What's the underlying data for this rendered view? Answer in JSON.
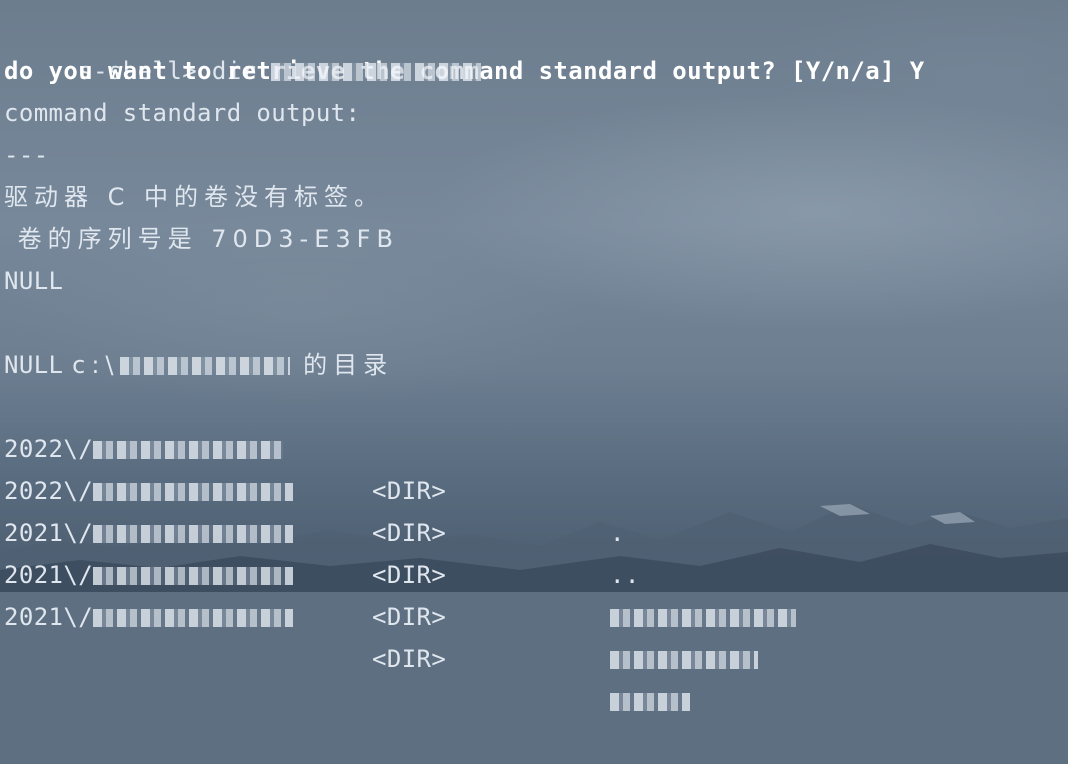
{
  "terminal": {
    "prompt_line": "os-shell> dir",
    "question": "do you want to retrieve the command standard output? [Y/n/a] Y",
    "output_header": "command standard output:",
    "separator": "---",
    "volume_label_line": "驱动器 C 中的卷没有标签。",
    "volume_serial_line": " 卷的序列号是 70D3-E3FB",
    "null_1": "NULL",
    "directory_prefix": " c:\\",
    "directory_suffix": " 的目录",
    "null_2": "NULL",
    "rows": [
      {
        "date": "2022\\/",
        "tag": "<DIR>",
        "name": "."
      },
      {
        "date": "2022\\/",
        "tag": "<DIR>",
        "name": ".."
      },
      {
        "date": "2021\\/",
        "tag": "<DIR>",
        "name": ""
      },
      {
        "date": "2021\\/",
        "tag": "<DIR>",
        "name": ""
      },
      {
        "date": "2021\\/",
        "tag": "<DIR>",
        "name": ""
      }
    ]
  }
}
